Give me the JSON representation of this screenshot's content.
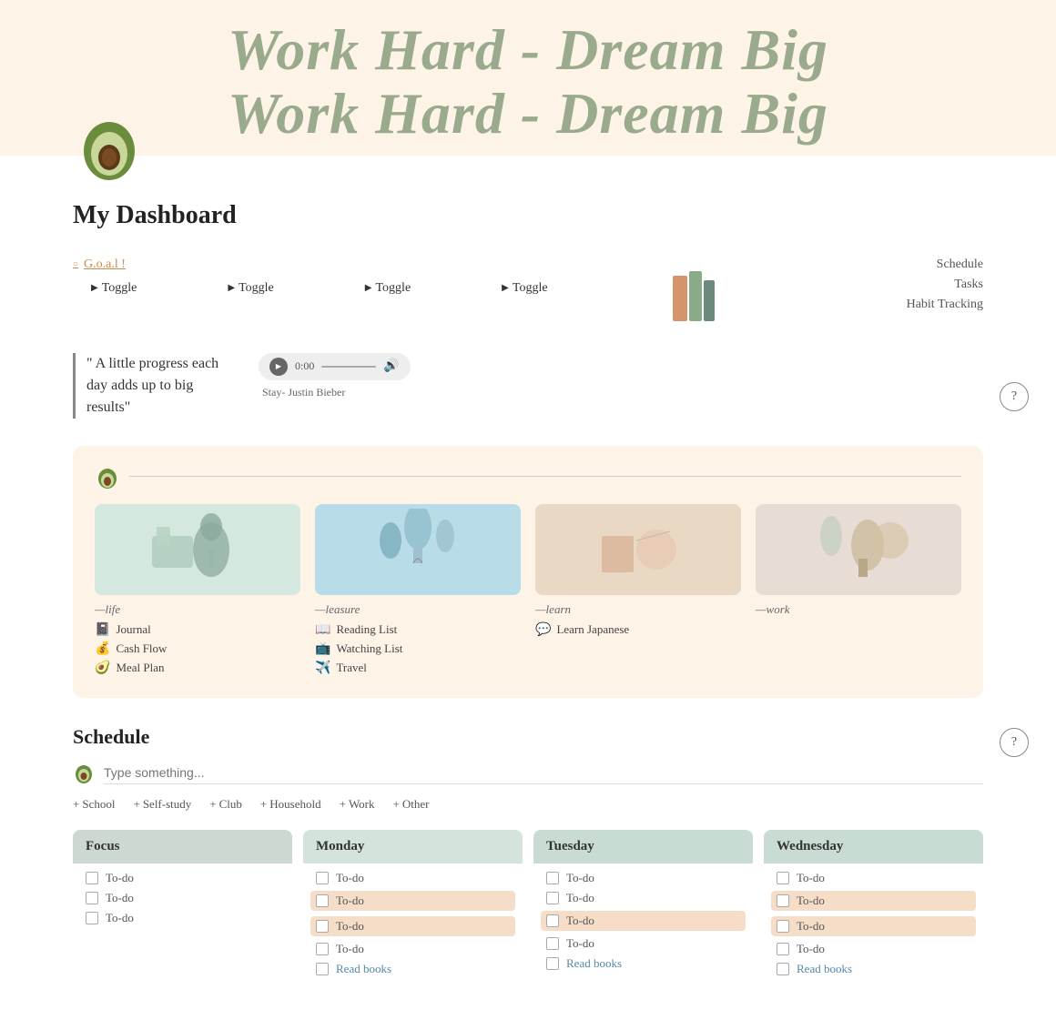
{
  "header": {
    "banner_line1": "Work Hard - Dream Big",
    "banner_line2": "Work Hard - Dream Big"
  },
  "dashboard": {
    "title": "My Dashboard",
    "goal_link": "G.o.a.l !",
    "toggles": [
      "Toggle",
      "Toggle",
      "Toggle",
      "Toggle"
    ],
    "right_nav": [
      "Schedule",
      "Tasks",
      "Habit Tracking"
    ],
    "quote": "\" A little progress each day adds up to big results\"",
    "audio_time": "0:00",
    "audio_label": "Stay- Justin Bieber",
    "sections": [
      {
        "name": "life",
        "label": "—life",
        "links": [
          {
            "icon": "📓",
            "text": "Journal"
          },
          {
            "icon": "💰",
            "text": "Cash Flow"
          },
          {
            "icon": "🥑",
            "text": "Meal Plan"
          }
        ]
      },
      {
        "name": "leasure",
        "label": "—leasure",
        "links": [
          {
            "icon": "📖",
            "text": "Reading List"
          },
          {
            "icon": "📺",
            "text": "Watching List"
          },
          {
            "icon": "✈️",
            "text": "Travel"
          }
        ]
      },
      {
        "name": "learn",
        "label": "—learn",
        "links": [
          {
            "icon": "💬",
            "text": "Learn Japanese"
          }
        ]
      },
      {
        "name": "work",
        "label": "—work",
        "links": []
      }
    ]
  },
  "schedule": {
    "title": "Schedule",
    "input_placeholder": "Type something...",
    "categories": [
      "School",
      "Self-study",
      "Club",
      "Household",
      "Work",
      "Other"
    ],
    "columns": [
      {
        "name": "Focus",
        "header_class": "col-header-focus",
        "items": [
          {
            "text": "To-do",
            "highlight": false
          },
          {
            "text": "To-do",
            "highlight": false
          },
          {
            "text": "To-do",
            "highlight": false
          }
        ]
      },
      {
        "name": "Monday",
        "header_class": "col-header-monday",
        "items": [
          {
            "text": "To-do",
            "highlight": false
          },
          {
            "text": "To-do",
            "highlight": true
          },
          {
            "text": "To-do",
            "highlight": true
          },
          {
            "text": "To-do",
            "highlight": false
          },
          {
            "text": "Read books",
            "highlight": false,
            "blue": true
          }
        ]
      },
      {
        "name": "Tuesday",
        "header_class": "col-header-tuesday",
        "items": [
          {
            "text": "To-do",
            "highlight": false
          },
          {
            "text": "To-do",
            "highlight": false
          },
          {
            "text": "To-do",
            "highlight": true
          },
          {
            "text": "To-do",
            "highlight": false
          },
          {
            "text": "Read books",
            "highlight": false,
            "blue": true
          }
        ]
      },
      {
        "name": "Wednesday",
        "header_class": "col-header-wednesday",
        "items": [
          {
            "text": "To-do",
            "highlight": false
          },
          {
            "text": "To-do",
            "highlight": true
          },
          {
            "text": "To-do",
            "highlight": true
          },
          {
            "text": "To-do",
            "highlight": false
          },
          {
            "text": "Read books",
            "highlight": false,
            "blue": true
          }
        ]
      }
    ]
  },
  "help_btn_label": "?"
}
